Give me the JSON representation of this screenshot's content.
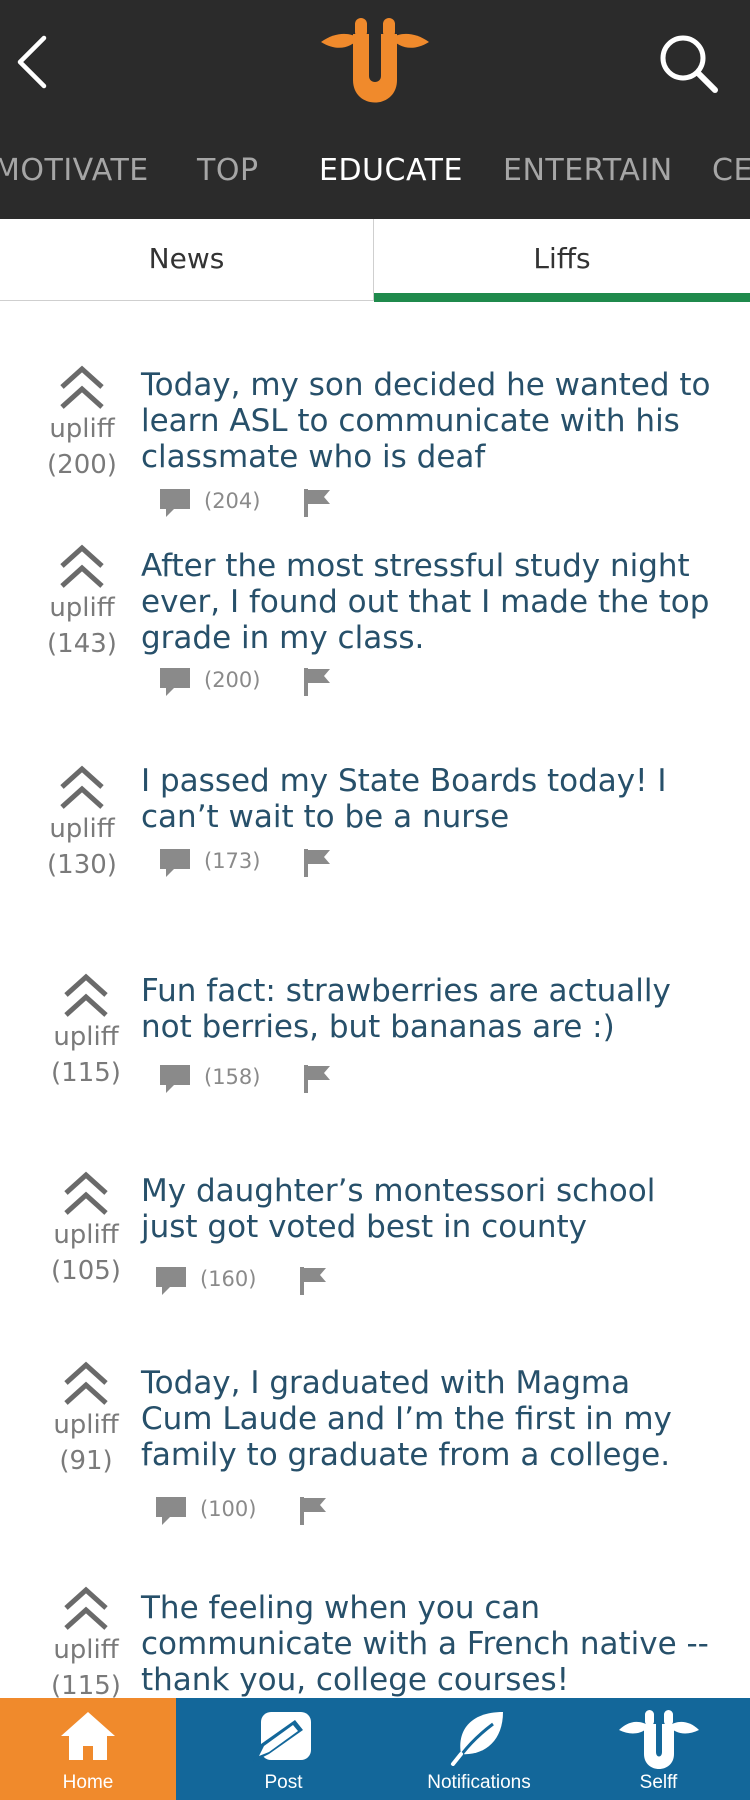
{
  "header": {
    "back_icon": "chevron-left-icon",
    "logo_icon": "upliff-giraffe-logo",
    "search_icon": "search-icon",
    "logo_color": "#f08a2c"
  },
  "categories": [
    {
      "label": "MOTIVATE",
      "active": false
    },
    {
      "label": "TOP",
      "active": false
    },
    {
      "label": "EDUCATE",
      "active": true
    },
    {
      "label": "ENTERTAIN",
      "active": false
    },
    {
      "label": "CE",
      "active": false
    }
  ],
  "subtabs": {
    "news": "News",
    "liffs": "Liffs",
    "selected": "Liffs",
    "accent": "#1f8a4c"
  },
  "posts": [
    {
      "vote_label": "upliff",
      "vote_count": "(200)",
      "text": "Today, my son decided he wanted to learn ASL to communicate with his classmate who is deaf",
      "comments": "(204)"
    },
    {
      "vote_label": "upliff",
      "vote_count": "(143)",
      "text": "After the most stressful study night ever, I found out that I made the top grade in my class.",
      "comments": "(200)"
    },
    {
      "vote_label": "upliff",
      "vote_count": "(130)",
      "text": "I passed my State Boards today! I can’t wait to be a nurse",
      "comments": "(173)"
    },
    {
      "vote_label": "upliff",
      "vote_count": "(115)",
      "text": "Fun fact: strawberries are actually not berries, but bananas are :)",
      "comments": "(158)"
    },
    {
      "vote_label": "upliff",
      "vote_count": "(105)",
      "text": "My daughter’s montessori school just got voted best in county",
      "comments": "(160)"
    },
    {
      "vote_label": "upliff",
      "vote_count": "(91)",
      "text": "Today, I graduated with Magma Cum Laude and I’m the first in my family to graduate from a college.",
      "comments": "(100)"
    },
    {
      "vote_label": "upliff",
      "vote_count": "(115)",
      "text": "The feeling when you can communicate with a French native -- thank you, college courses!",
      "comments": ""
    }
  ],
  "bottom_nav": [
    {
      "label": "Home",
      "icon": "home-icon",
      "active": true
    },
    {
      "label": "Post",
      "icon": "pencil-icon",
      "active": false
    },
    {
      "label": "Notifications",
      "icon": "leaf-icon",
      "active": false
    },
    {
      "label": "Selff",
      "icon": "giraffe-icon",
      "active": false
    }
  ],
  "colors": {
    "header_bg": "#2b2b2b",
    "nav_bg": "#13679a",
    "nav_active": "#f08a2c",
    "post_text": "#27506a"
  }
}
